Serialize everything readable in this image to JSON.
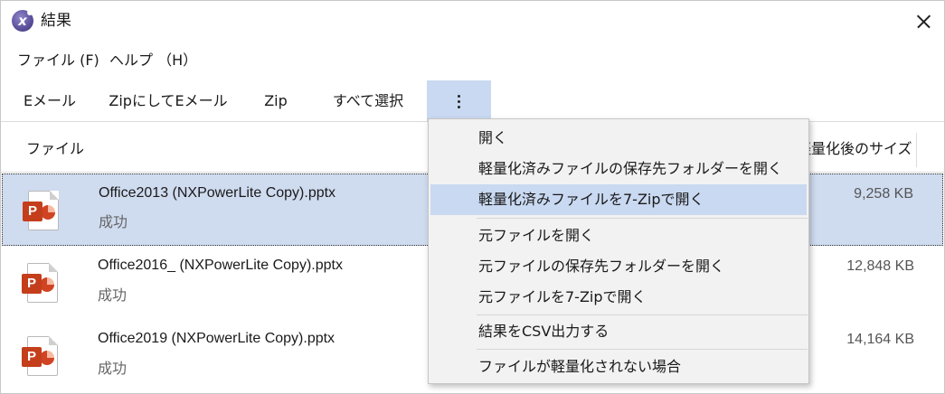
{
  "window": {
    "title": "結果"
  },
  "menubar": {
    "file": "ファイル (F)",
    "help": "ヘルプ （H）"
  },
  "toolbar": {
    "email": "Eメール",
    "zip_email": "ZipにしてEメール",
    "zip": "Zip",
    "select_all": "すべて選択",
    "more_icon": "vertical-ellipsis"
  },
  "table": {
    "headers": {
      "file": "ファイル",
      "size": "軽量化後のサイズ"
    },
    "rows": [
      {
        "name": "Office2013 (NXPowerLite Copy).pptx",
        "status": "成功",
        "size": "9,258 KB",
        "icon": "powerpoint-file",
        "selected": true
      },
      {
        "name": "Office2016_ (NXPowerLite Copy).pptx",
        "status": "成功",
        "size": "12,848 KB",
        "icon": "powerpoint-file"
      },
      {
        "name": "Office2019 (NXPowerLite Copy).pptx",
        "status": "成功",
        "size": "14,164 KB",
        "icon": "powerpoint-file"
      }
    ]
  },
  "dropdown": {
    "items": [
      "開く",
      "軽量化済みファイルの保存先フォルダーを開く",
      "軽量化済みファイルを7-Zipで開く",
      "元ファイルを開く",
      "元ファイルの保存先フォルダーを開く",
      "元ファイルを7-Zipで開く",
      "結果をCSV出力する",
      "ファイルが軽量化されない場合"
    ],
    "highlighted_index": 2
  },
  "colors": {
    "selection": "#cfdbef",
    "hover": "#c9d9f1",
    "ppt_red": "#c43e1c"
  }
}
